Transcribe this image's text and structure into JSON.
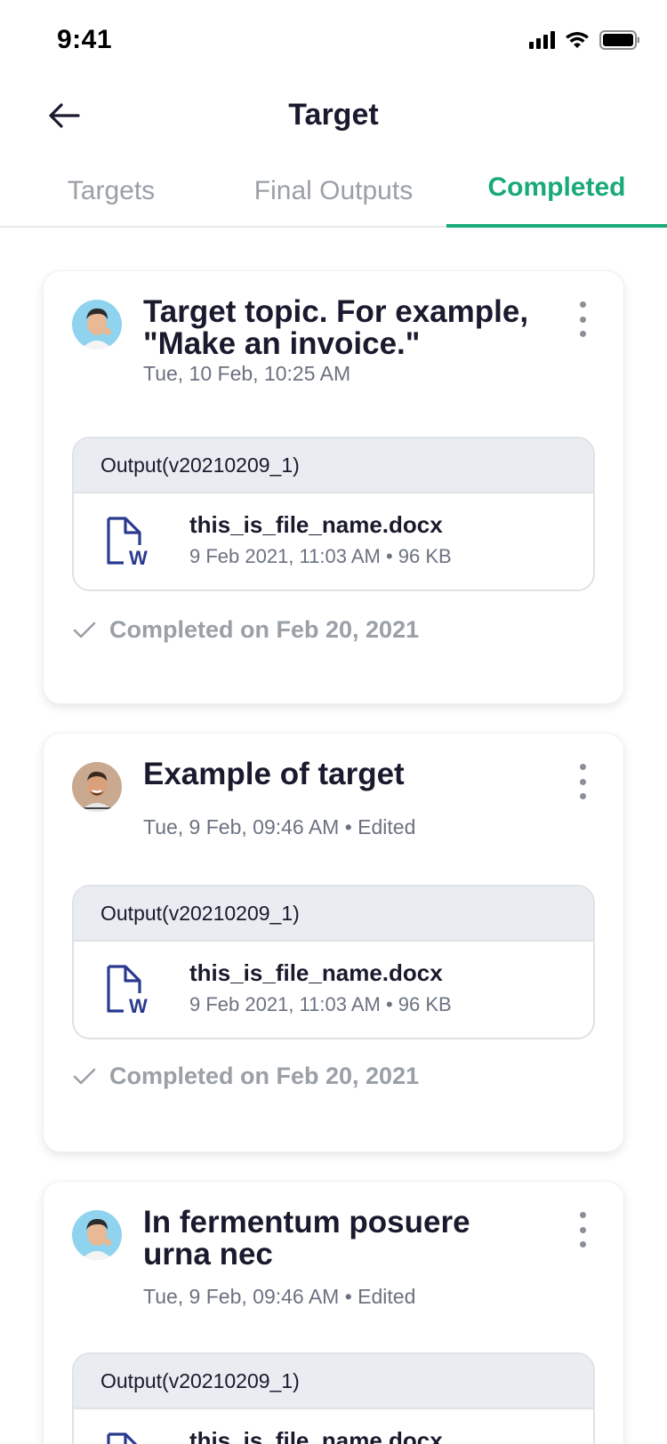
{
  "status_bar": {
    "time": "9:41"
  },
  "header": {
    "title": "Target"
  },
  "tabs": [
    {
      "label": "Targets",
      "active": false
    },
    {
      "label": "Final Outputs",
      "active": false
    },
    {
      "label": "Completed",
      "active": true
    }
  ],
  "colors": {
    "accent": "#1aaa7a",
    "file_icon": "#2a3b8f",
    "muted": "#9aa0a6"
  },
  "cards": [
    {
      "title": "Target topic. For example, \"Make an invoice.\"",
      "date": "Tue, 10 Feb, 10:25 AM",
      "output_label": "Output(v20210209_1)",
      "file_name": "this_is_file_name.docx",
      "file_meta": "9 Feb 2021, 11:03 AM • 96 KB",
      "completed": "Completed on Feb 20, 2021"
    },
    {
      "title": "Example of target",
      "date": "Tue, 9 Feb, 09:46 AM • Edited",
      "output_label": "Output(v20210209_1)",
      "file_name": "this_is_file_name.docx",
      "file_meta": "9 Feb 2021, 11:03 AM • 96 KB",
      "completed": "Completed on Feb 20, 2021"
    },
    {
      "title": "In fermentum posuere urna nec",
      "date": "Tue, 9 Feb, 09:46 AM • Edited",
      "output_label": "Output(v20210209_1)",
      "file_name": "this_is_file_name.docx"
    }
  ],
  "icons": {
    "back": "arrow-left-icon",
    "more": "more-vertical-icon",
    "file": "word-document-icon",
    "check": "check-icon"
  }
}
